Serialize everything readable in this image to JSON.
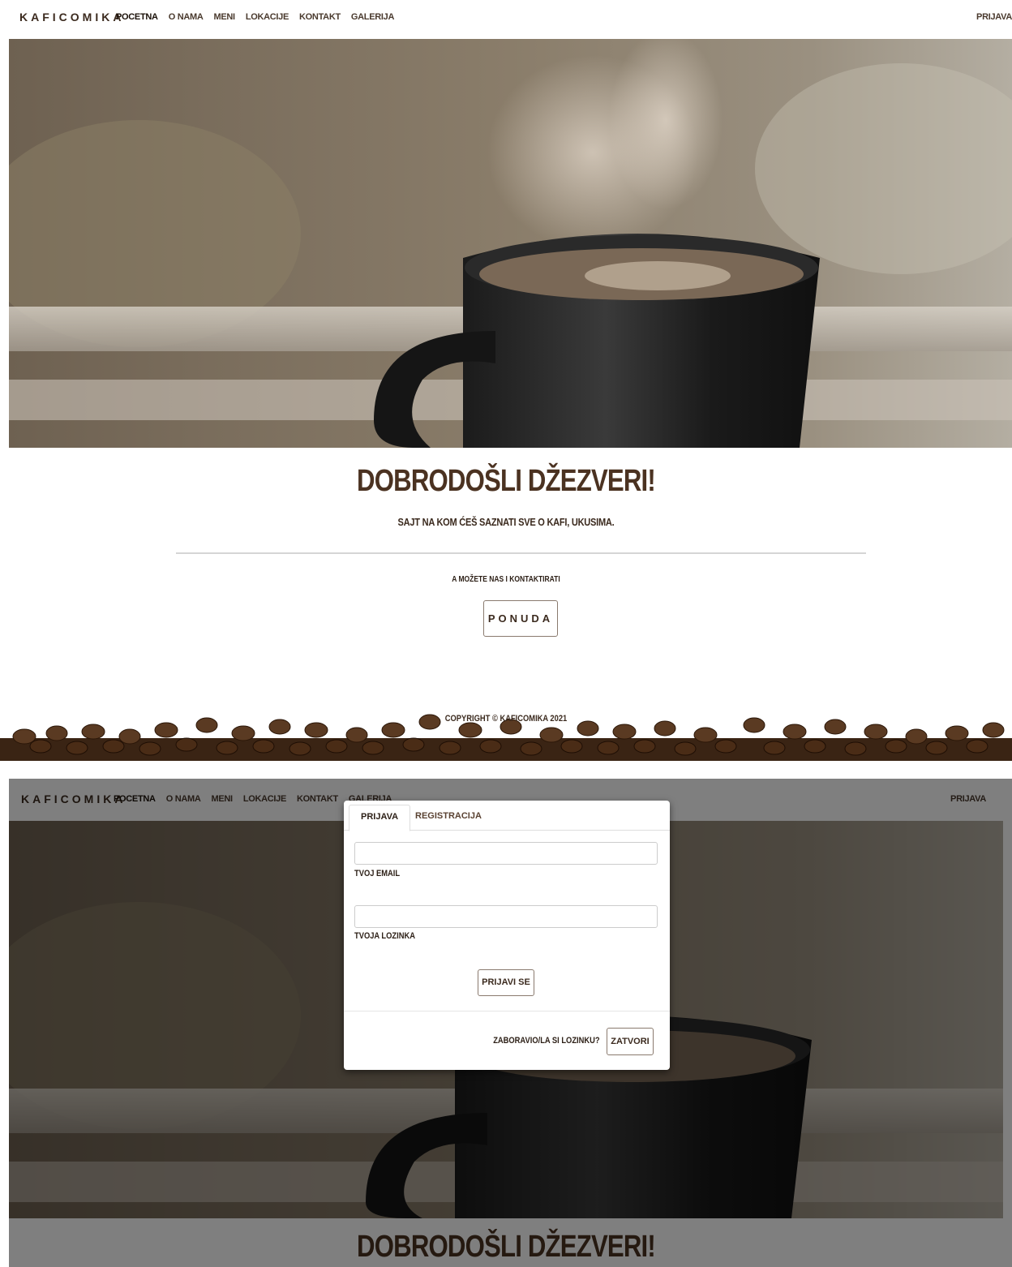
{
  "brand": "KAFICOMIKA",
  "nav": {
    "links": [
      "POCETNA",
      "O NAMA",
      "MENI",
      "LOKACIJE",
      "KONTAKT",
      "GALERIJA"
    ],
    "login": "PRIJAVA"
  },
  "hero": {
    "image": "steaming-coffee-cup"
  },
  "welcome": {
    "title": "DOBRODOŠLI DŽEZVERI!",
    "subtitle": "SAJT NA KOM ĆEŠ SAZNATI SVE O KAFI, UKUSIMA.",
    "contact_text": "A MOŽETE NAS I KONTAKTIRATI",
    "offer_button": "PONUDA"
  },
  "footer": {
    "copyright": "COPYRIGHT © KAFICOMIKA 2021"
  },
  "modal": {
    "tabs": [
      "PRIJAVA",
      "REGISTRACIJA"
    ],
    "email_label": "TVOJ EMAIL",
    "password_label": "TVOJA LOZINKA",
    "submit": "PRIJAVI SE",
    "forgot": "ZABORAVIO/LA SI LOZINKU?",
    "close": "ZATVORI"
  },
  "colors": {
    "brand_brown": "#4b3221",
    "text_dark": "#2d2017"
  }
}
